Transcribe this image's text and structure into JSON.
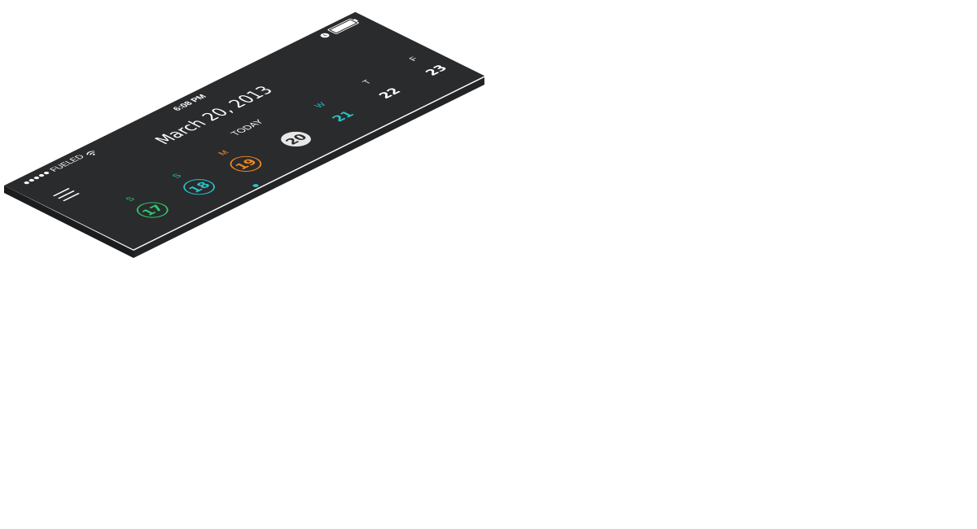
{
  "status_bar": {
    "carrier": "FUELED",
    "signal_dots": 5,
    "time": "6:08 PM",
    "battery_level": 0.9
  },
  "header": {
    "date_title": "March 20, 2013",
    "today_label": "TODAY"
  },
  "icons": {
    "menu": "hamburger-menu-icon",
    "wifi": "wifi-icon",
    "alarm": "alarm-clock-icon",
    "battery": "battery-icon"
  },
  "colors": {
    "panel": "#2a2b2d",
    "panel_edge": "#1b1c1d",
    "green": "#2ecc71",
    "teal": "#29c4c9",
    "orange": "#f08a24",
    "white": "#ffffff",
    "today_fill": "#e8e8e8"
  },
  "days": [
    {
      "letter": "S",
      "number": "17",
      "color": "#2ecc71",
      "style": "ring"
    },
    {
      "letter": "S",
      "number": "18",
      "color": "#29c4c9",
      "style": "ring"
    },
    {
      "letter": "M",
      "number": "19",
      "color": "#f08a24",
      "style": "ring"
    },
    {
      "letter": "",
      "number": "20",
      "color": "#e8e8e8",
      "style": "today"
    },
    {
      "letter": "W",
      "number": "21",
      "color": "#29c4c9",
      "style": "plain"
    },
    {
      "letter": "T",
      "number": "22",
      "color": "#ffffff",
      "style": "plain"
    },
    {
      "letter": "F",
      "number": "23",
      "color": "#ffffff",
      "style": "plain"
    }
  ]
}
